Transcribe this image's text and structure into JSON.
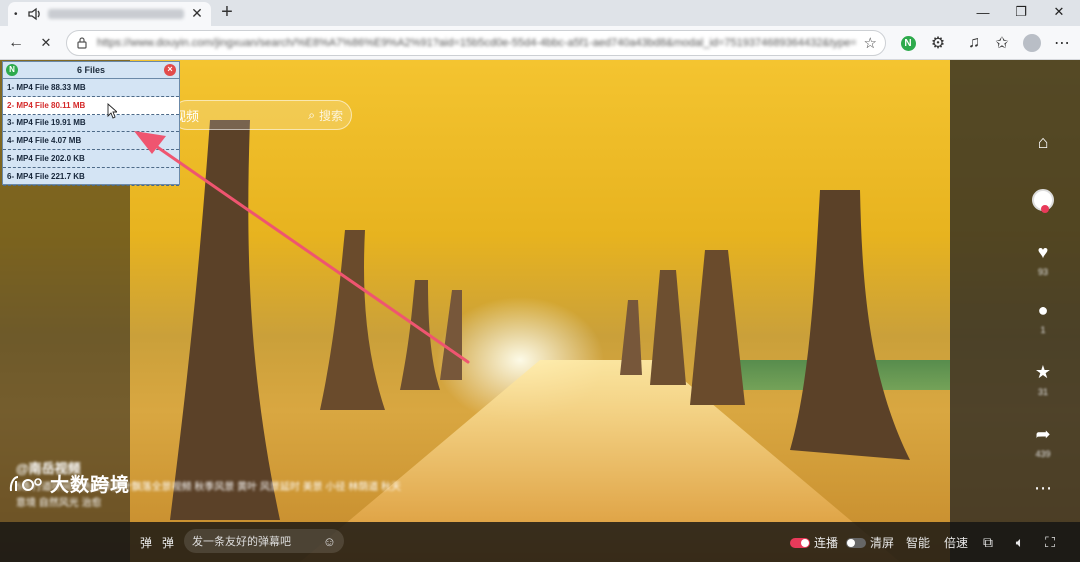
{
  "browser": {
    "tab": {
      "title": "",
      "dot": "•"
    },
    "new_tab_symbol": "+",
    "window_controls": {
      "minimize": "—",
      "maximize": "❐",
      "close": "✕"
    },
    "nav": {
      "back": "←",
      "stop": "✕"
    },
    "address_url": "https://www.douyin.com/jingxuan/search/%E8%A7%86%E9%A2%91?aid=15b5cd0e-55d4-4bbc-a5f1-aed740a43bd8&modal_id=7519374689364432&type=general"
  },
  "page": {
    "search": {
      "placeholder": "视频",
      "button": "搜索"
    },
    "author": "@南岳视频",
    "description": "5条行道叶间景色秋季黄叶飘落全景视频 秋季风景 黄叶 风景延时 美景 小径 林荫道 秋天 意境 自然风光 治愈",
    "rail": [
      {
        "icon": "home-icon",
        "glyph": "⌂",
        "count": ""
      },
      {
        "icon": "avatar-icon",
        "glyph": "●",
        "count": ""
      },
      {
        "icon": "heart-icon",
        "glyph": "♥",
        "count": "93"
      },
      {
        "icon": "comment-icon",
        "glyph": "●",
        "count": "1"
      },
      {
        "icon": "star-icon",
        "glyph": "★",
        "count": "31"
      },
      {
        "icon": "share-icon",
        "glyph": "➦",
        "count": "439"
      },
      {
        "icon": "more-icon",
        "glyph": "⋯",
        "count": ""
      }
    ],
    "control_bar": {
      "danmu_placeholder": "发一条友好的弹幕吧",
      "danmu_left": "弹",
      "autoplay_label": "连播",
      "clear_label": "清屏",
      "smart_label": "智能",
      "speed_label": "倍速"
    },
    "watermark": "大数跨境"
  },
  "download_panel": {
    "title": "6 Files",
    "files": [
      "1- MP4 File 88.33 MB",
      "2- MP4 File 80.11 MB",
      "3- MP4 File 19.91 MB",
      "4- MP4 File 4.07 MB",
      "5- MP4 File 202.0 KB",
      "6- MP4 File 221.7 KB"
    ],
    "active_index": 1
  },
  "colors": {
    "annotation_arrow": "#ef5570",
    "active_file_text": "#d42a2a",
    "panel_bg": "#d4e4f4",
    "extension_green": "#2eaa4c"
  }
}
